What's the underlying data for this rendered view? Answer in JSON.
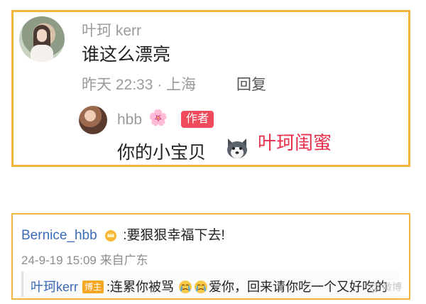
{
  "comment_top": {
    "username": "叶珂 kerr",
    "message": "谁这么漂亮",
    "meta": "昨天 22:33 · 上海",
    "reply_label": "回复",
    "reply": {
      "username": "hbb",
      "flower_icon": "🌸",
      "badge": "作者",
      "message": "你的小宝贝"
    }
  },
  "annotation": "叶珂闺蜜",
  "comment_bottom": {
    "username": "Bernice_hbb",
    "message": ":要狠狠幸福下去!",
    "meta": "24-9-19 15:09 来自广东",
    "sub_reply": {
      "username": "叶珂kerr",
      "badge": "博主",
      "message_start": ":连累你被骂",
      "message_end": "爱你，回来请你吃一个又好吃的"
    }
  },
  "watermark": "@ 微博",
  "colors": {
    "border": "#f2b63c",
    "annotation": "#e8304d",
    "author_badge": "#ef4a5c",
    "link_username": "#3c6ab4",
    "blogger_badge": "#f5a623"
  },
  "icons": [
    "avatar-photo",
    "flower-icon",
    "husky-emoji-icon",
    "crown-icon",
    "crying-face-icon"
  ]
}
